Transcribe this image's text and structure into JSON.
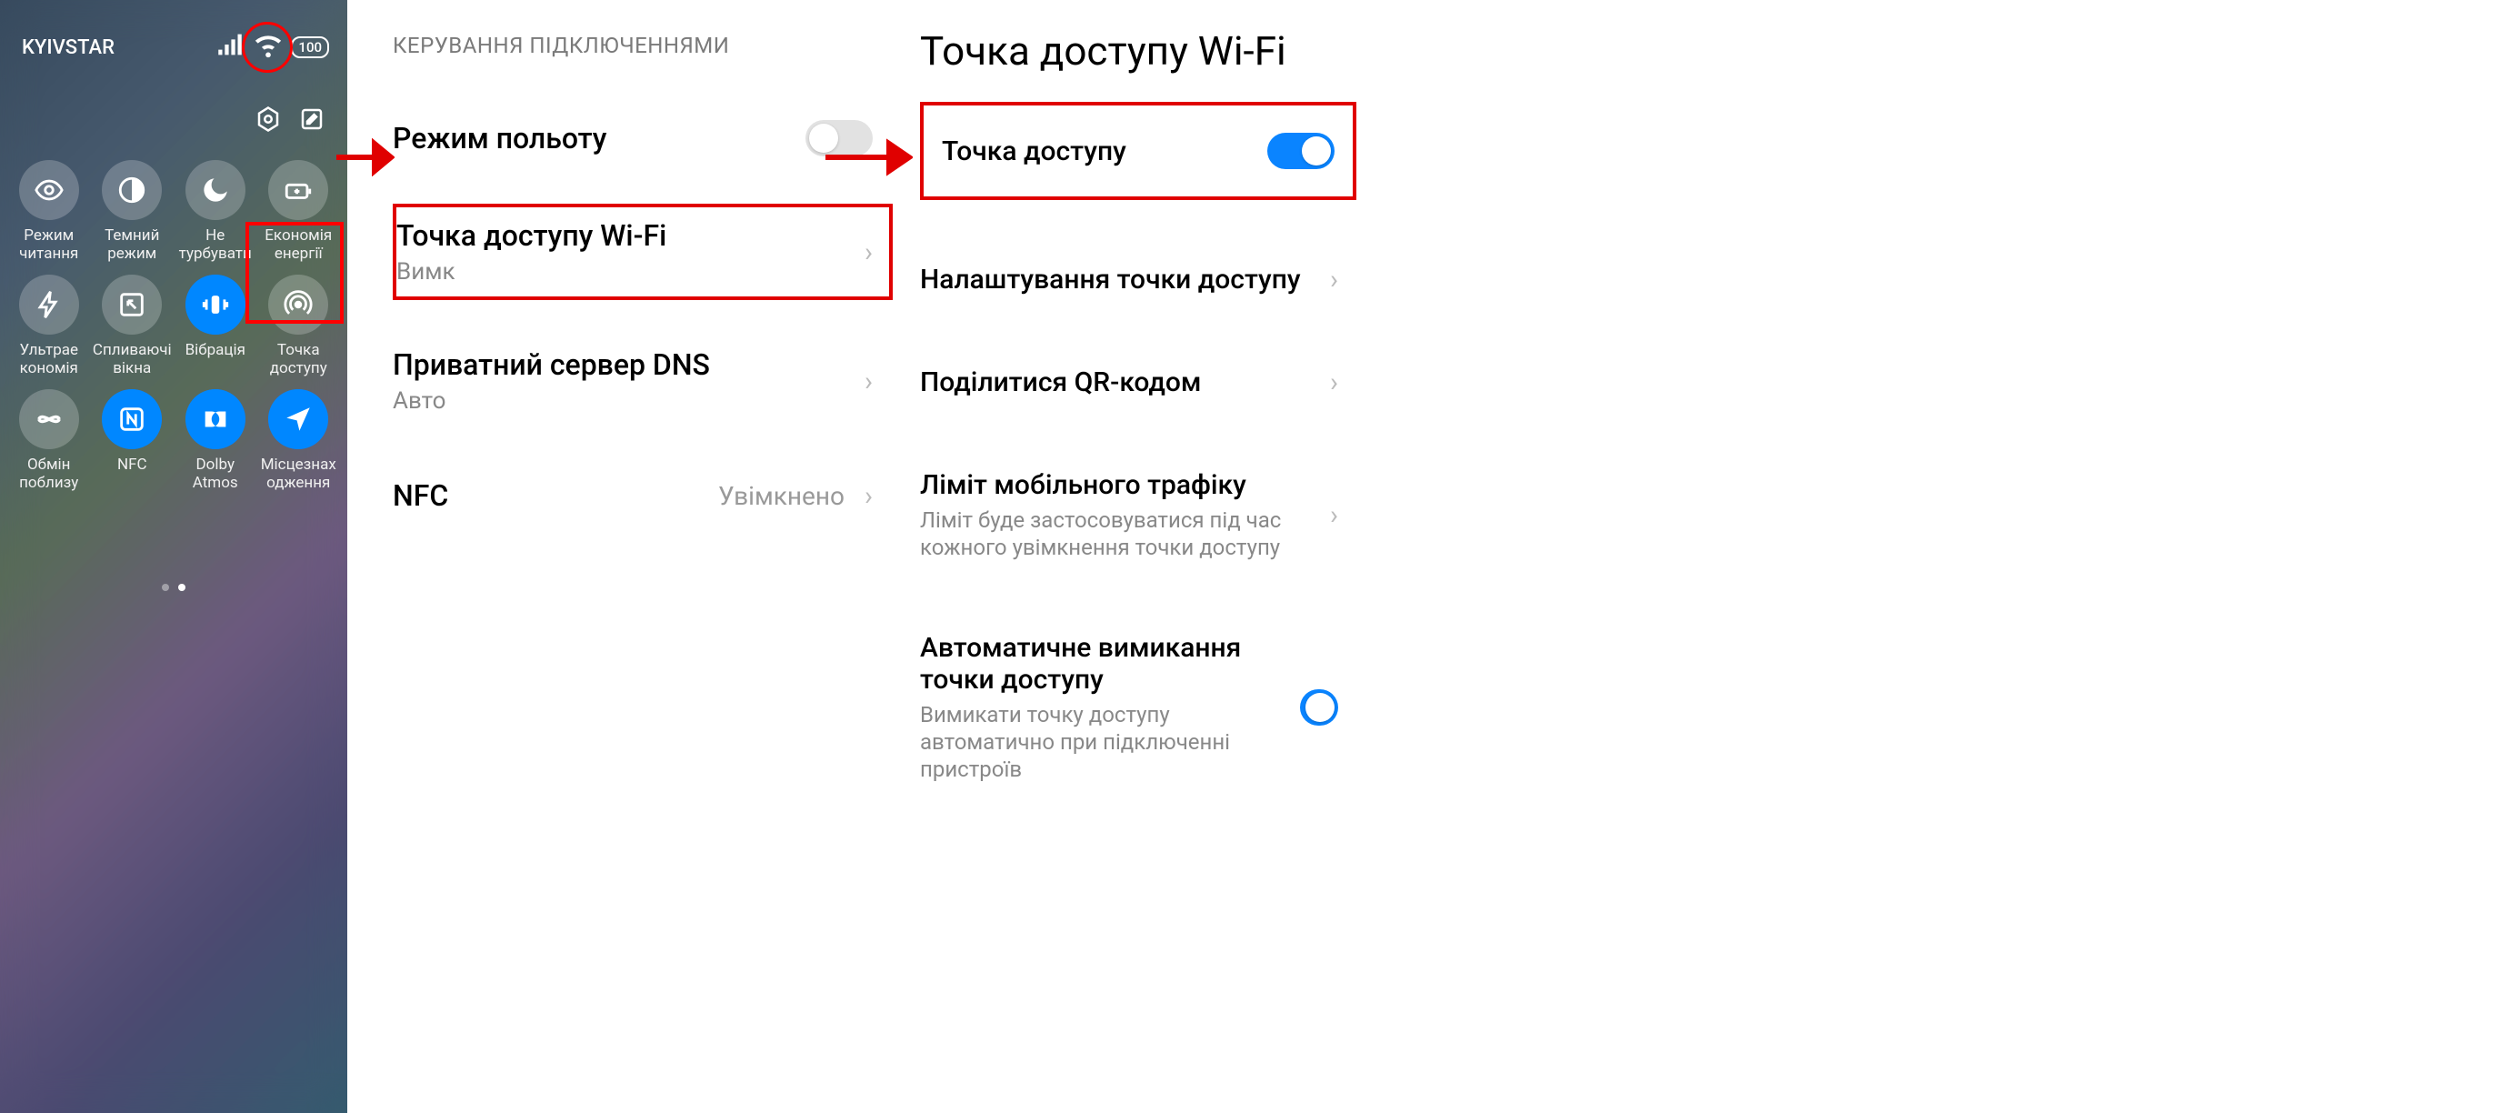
{
  "panel1": {
    "carrier": "KYIVSTAR",
    "battery": "100",
    "tiles": [
      {
        "label": "Режим читання",
        "active": false,
        "icon": "eye"
      },
      {
        "label": "Темний режим",
        "active": false,
        "icon": "contrast"
      },
      {
        "label": "Не турбувати",
        "active": false,
        "icon": "moon"
      },
      {
        "label": "Економія енергії",
        "active": false,
        "icon": "battery-plus"
      },
      {
        "label": "Ультрае кономія",
        "active": false,
        "icon": "bolt"
      },
      {
        "label": "Спливаючі вікна",
        "active": false,
        "icon": "popup"
      },
      {
        "label": "Вібрація",
        "active": true,
        "icon": "vibrate"
      },
      {
        "label": "Точка доступу",
        "active": false,
        "icon": "hotspot"
      },
      {
        "label": "Обмін поблизу",
        "active": false,
        "icon": "nearby"
      },
      {
        "label": "NFC",
        "active": true,
        "icon": "nfc"
      },
      {
        "label": "Dolby Atmos",
        "active": true,
        "icon": "dolby"
      },
      {
        "label": "Місцезнах одження",
        "active": true,
        "icon": "location"
      }
    ]
  },
  "panel2": {
    "header": "КЕРУВАННЯ ПІДКЛЮЧЕННЯМИ",
    "airplane": {
      "title": "Режим польоту",
      "on": false
    },
    "hotspot": {
      "title": "Точка доступу Wi-Fi",
      "sub": "Вимк"
    },
    "dns": {
      "title": "Приватний сервер DNS",
      "sub": "Авто"
    },
    "nfc": {
      "title": "NFC",
      "value": "Увімкнено"
    }
  },
  "panel3": {
    "title": "Точка доступу Wi-Fi",
    "hotspot": {
      "title": "Точка доступу",
      "on": true
    },
    "settings": {
      "title": "Налаштування точки доступу"
    },
    "qr": {
      "title": "Поділитися QR-кодом"
    },
    "limit": {
      "title": "Ліміт мобільного трафіку",
      "sub": "Ліміт буде застосовуватися під час кожного увімкнення точки доступу"
    },
    "auto": {
      "title": "Автоматичне вимикання точки доступу",
      "sub": "Вимикати точку доступу автоматично при підключенні пристроїв",
      "on": true
    }
  }
}
